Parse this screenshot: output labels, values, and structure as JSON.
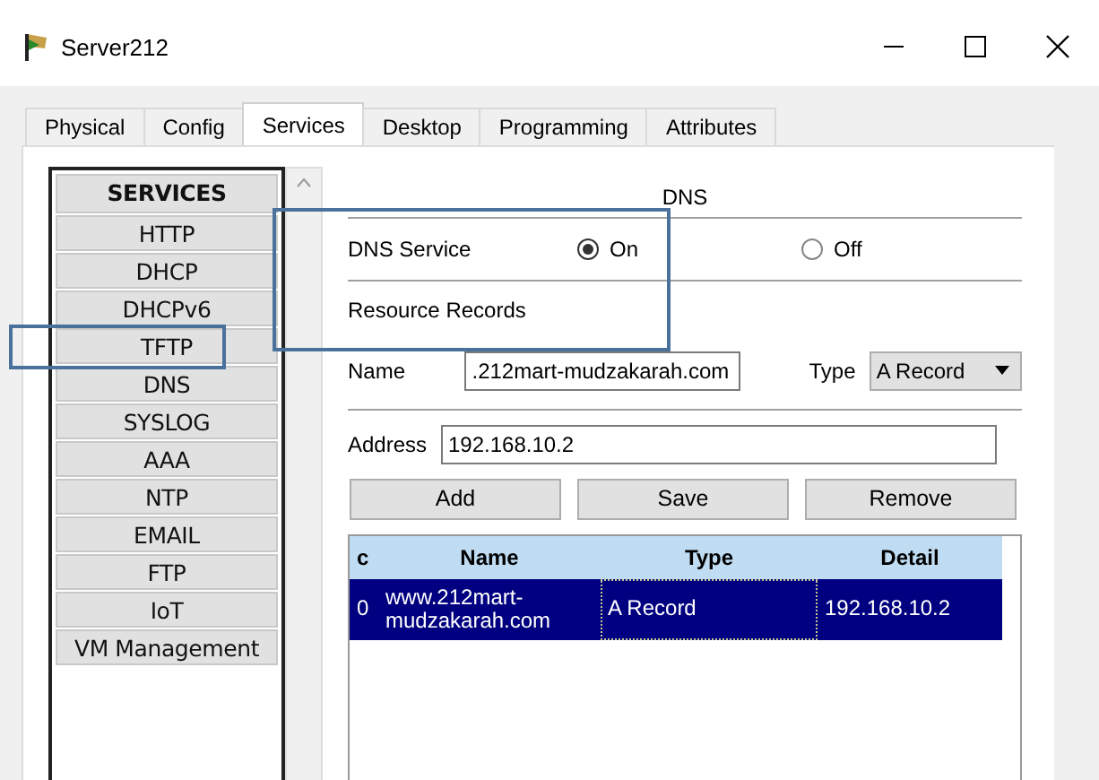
{
  "window": {
    "title": "Server212"
  },
  "tabs": [
    {
      "label": "Physical",
      "selected": false
    },
    {
      "label": "Config",
      "selected": false
    },
    {
      "label": "Services",
      "selected": true
    },
    {
      "label": "Desktop",
      "selected": false
    },
    {
      "label": "Programming",
      "selected": false
    },
    {
      "label": "Attributes",
      "selected": false
    }
  ],
  "services": {
    "header": "SERVICES",
    "items": [
      "HTTP",
      "DHCP",
      "DHCPv6",
      "TFTP",
      "DNS",
      "SYSLOG",
      "AAA",
      "NTP",
      "EMAIL",
      "FTP",
      "IoT",
      "VM Management"
    ]
  },
  "dns": {
    "title": "DNS",
    "service_label": "DNS Service",
    "options": [
      {
        "label": "On",
        "selected": true
      },
      {
        "label": "Off",
        "selected": false
      }
    ],
    "records_label": "Resource Records",
    "name": {
      "label": "Name",
      "value": ".212mart-mudzakarah.com"
    },
    "type": {
      "label": "Type",
      "value": "A Record"
    },
    "address": {
      "label": "Address",
      "value": "192.168.10.2"
    },
    "buttons": [
      "Add",
      "Save",
      "Remove"
    ],
    "table": {
      "columns": [
        "c",
        "Name",
        "Type",
        "Detail"
      ],
      "rows": [
        {
          "cells": [
            "0",
            "www.212mart-mudzakarah.com",
            "A Record",
            "192.168.10.2"
          ],
          "selected": true
        }
      ]
    }
  }
}
